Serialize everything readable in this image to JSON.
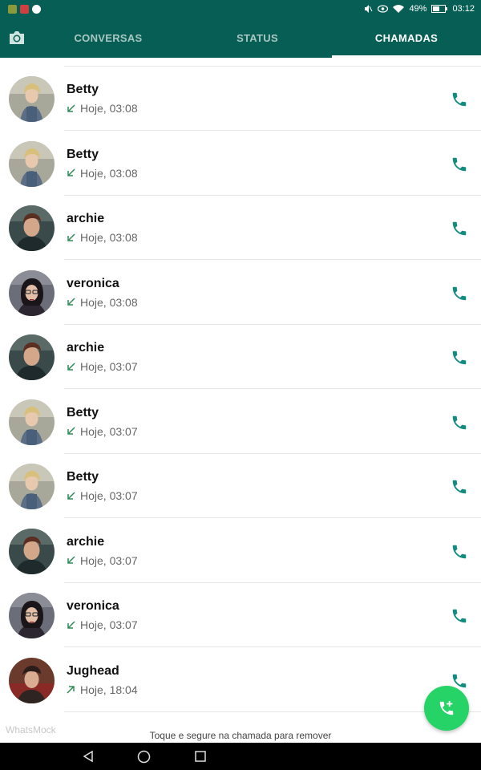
{
  "status_bar": {
    "battery": "49%",
    "time": "03:12"
  },
  "tabs": [
    {
      "label": "CONVERSAS",
      "active": false
    },
    {
      "label": "STATUS",
      "active": false
    },
    {
      "label": "CHAMADAS",
      "active": true
    }
  ],
  "calls": [
    {
      "name": "Betty",
      "time": "Hoje, 03:08",
      "direction": "incoming",
      "avatar": "betty"
    },
    {
      "name": "Betty",
      "time": "Hoje, 03:08",
      "direction": "incoming",
      "avatar": "betty"
    },
    {
      "name": "archie",
      "time": "Hoje, 03:08",
      "direction": "incoming",
      "avatar": "archie"
    },
    {
      "name": "veronica",
      "time": "Hoje, 03:08",
      "direction": "incoming",
      "avatar": "veronica"
    },
    {
      "name": "archie",
      "time": "Hoje, 03:07",
      "direction": "incoming",
      "avatar": "archie"
    },
    {
      "name": "Betty",
      "time": "Hoje, 03:07",
      "direction": "incoming",
      "avatar": "betty"
    },
    {
      "name": "Betty",
      "time": "Hoje, 03:07",
      "direction": "incoming",
      "avatar": "betty"
    },
    {
      "name": "archie",
      "time": "Hoje, 03:07",
      "direction": "incoming",
      "avatar": "archie"
    },
    {
      "name": "veronica",
      "time": "Hoje, 03:07",
      "direction": "incoming",
      "avatar": "veronica"
    },
    {
      "name": "Jughead",
      "time": "Hoje, 18:04",
      "direction": "outgoing",
      "avatar": "jughead"
    }
  ],
  "watermark": "WhatsMock",
  "hint": "Toque e segure na chamada para remover",
  "colors": {
    "app_bar": "#075e54",
    "accent": "#128c7e",
    "fab": "#25d366",
    "call_arrow": "#2e8b57"
  }
}
